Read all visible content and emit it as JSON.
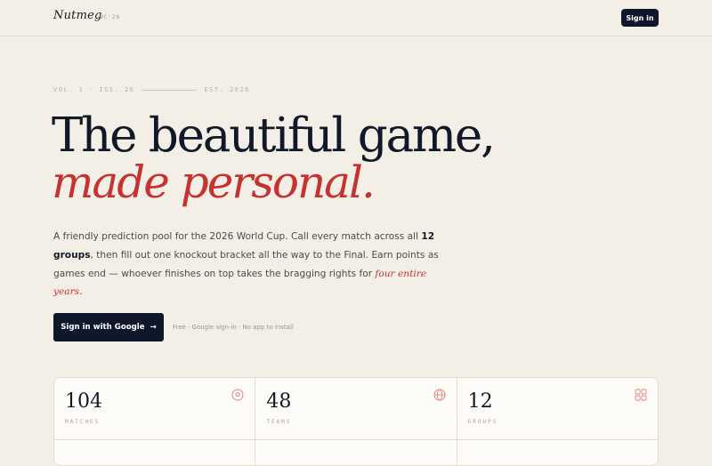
{
  "header": {
    "brand": "Nutmeg",
    "brand_tag": "WC'26",
    "signin_label": "Sign in"
  },
  "hero": {
    "issue_left": "VOL. 1 · ISS. 26",
    "issue_right": "EST. 2026",
    "line1": "The beautiful game,",
    "line2": "made personal."
  },
  "intro": {
    "p1": "A friendly prediction pool for the 2026 World Cup. Call every match across all ",
    "groups_strong": "12 groups",
    "p2": ", then fill out one knockout bracket all the way to the Final. Earn points as games end — whoever finishes on top takes the bragging rights for ",
    "years_em": "four entire years",
    "p3": "."
  },
  "cta": {
    "google_label": "Sign in with Google",
    "arrow": "→",
    "note": "Free · Google sign-in · No app to install"
  },
  "stats": [
    {
      "value": "104",
      "label": "MATCHES",
      "icon": "soccer-ball-icon"
    },
    {
      "value": "48",
      "label": "TEAMS",
      "icon": "globe-icon"
    },
    {
      "value": "12",
      "label": "GROUPS",
      "icon": "grid-icon"
    }
  ],
  "colors": {
    "accent": "#c5322f",
    "navy": "#0f172a",
    "background": "#f3efe6"
  }
}
